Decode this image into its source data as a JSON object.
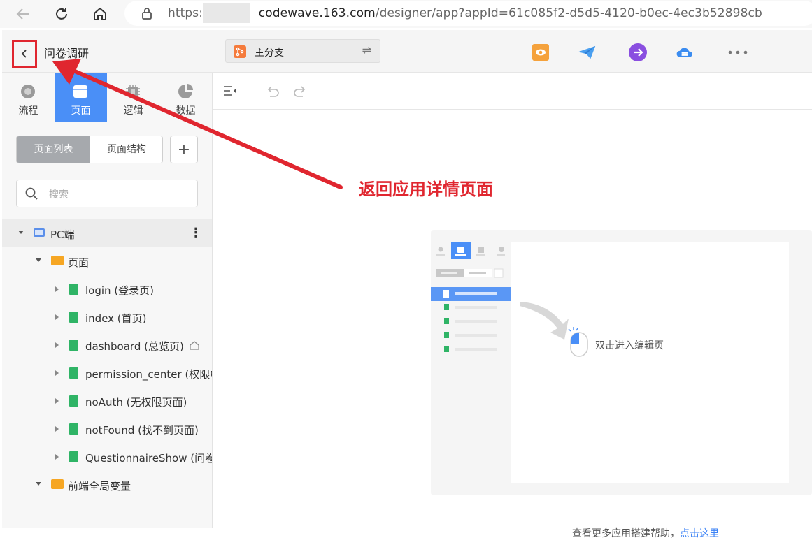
{
  "browser": {
    "url_prefix": "https://",
    "url_domain": "codewave.163.com",
    "url_path": "/designer/app?appId=61c085f2-d5d5-4120-b0ec-4ec3b52898cb"
  },
  "header": {
    "app_title": "问卷调研",
    "branch_label": "主分支"
  },
  "sidebar": {
    "tabs": [
      {
        "label": "流程",
        "icon": "flow-icon"
      },
      {
        "label": "页面",
        "icon": "page-icon",
        "active": true
      },
      {
        "label": "逻辑",
        "icon": "logic-icon"
      },
      {
        "label": "数据",
        "icon": "data-icon"
      }
    ],
    "segment": {
      "list": "页面列表",
      "tree": "页面结构"
    },
    "add_label": "+",
    "search_placeholder": "搜索",
    "tree": {
      "pc": "PC端",
      "pages_folder": "页面",
      "pages": [
        "login (登录页)",
        "index (首页)",
        "dashboard (总览页)",
        "permission_center (权限中",
        "noAuth (无权限页面)",
        "notFound (找不到页面)",
        "QuestionnaireShow (问卷"
      ],
      "global_vars": "前端全局变量"
    }
  },
  "canvas": {
    "hint": "双击进入编辑页",
    "help_text": "查看更多应用搭建帮助，",
    "help_link": "点击这里"
  },
  "annotation": {
    "callout": "返回应用详情页面",
    "color": "#e0262f"
  },
  "colors": {
    "accent": "#4a8ff7",
    "page_icon": "#2fb466",
    "folder_icon": "#f6a623"
  }
}
